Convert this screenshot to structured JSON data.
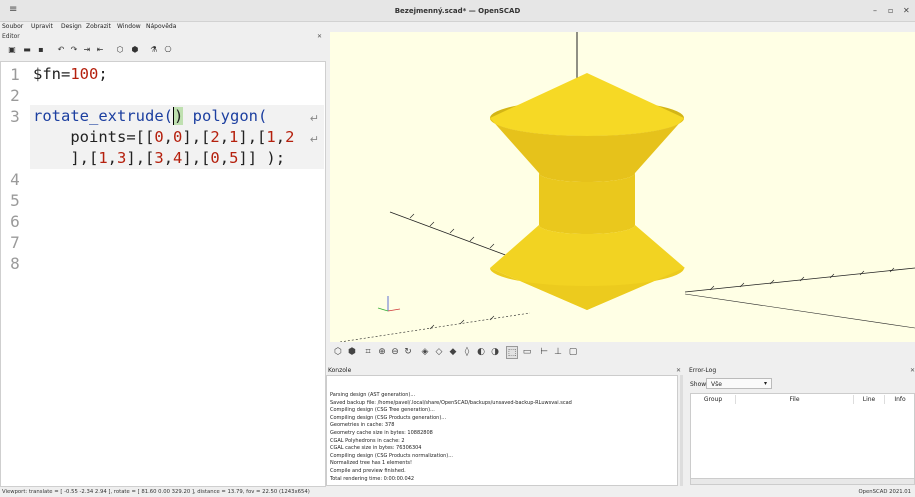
{
  "window": {
    "title": "Bezejmenný.scad* — OpenSCAD"
  },
  "menu": [
    "Soubor",
    "Upravit",
    "Design",
    "Zobrazit",
    "Window",
    "Nápověda"
  ],
  "editor": {
    "label": "Editor",
    "line_numbers": [
      "1",
      "2",
      "3",
      "4",
      "5",
      "6",
      "7",
      "8"
    ],
    "code": {
      "l1a": "$fn=",
      "l1b": "100",
      "l1c": ";",
      "l3a": "rotate_extrude(",
      "l3b": ")",
      "l3c": " polygon(",
      "l4a": "    points=[[",
      "l4b": "0",
      "l4c": ",",
      "l4d": "0",
      "l4e": "],[",
      "l4f": "2",
      "l4g": ",",
      "l4h": "1",
      "l4i": "],[",
      "l4j": "1",
      "l4k": ",",
      "l4l": "2",
      "l5a": "    ],[",
      "l5b": "1",
      "l5c": ",",
      "l5d": "3",
      "l5e": "],[",
      "l5f": "3",
      "l5g": ",",
      "l5h": "4",
      "l5i": "],[",
      "l5j": "0",
      "l5k": ",",
      "l5l": "5",
      "l5m": "]] );"
    }
  },
  "console": {
    "label": "Konzole",
    "lines": [
      "Parsing design (AST generation)...",
      "Saved backup file: /home/pavel/.local/share/OpenSCAD/backups/unsaved-backup-RLuwsvai.scad",
      "Compiling design (CSG Tree generation)...",
      "Compiling design (CSG Products generation)...",
      "Geometries in cache: 378",
      "Geometry cache size in bytes: 10882808",
      "CGAL Polyhedrons in cache: 2",
      "CGAL cache size in bytes: 76306304",
      "Compiling design (CSG Products normalization)...",
      "Normalized tree has 1 elements!",
      "Compile and preview finished.",
      "Total rendering time: 0:00:00.042"
    ]
  },
  "errorlog": {
    "label": "Error-Log",
    "show_label": "Show",
    "show_value": "Vše",
    "columns": [
      "Group",
      "File",
      "Line",
      "Info"
    ]
  },
  "status": {
    "viewport": "Viewport: translate = [ -0.55 -2.34 2.94 ], rotate = [ 81.60 0.00 329.20 ], distance = 13.79, fov = 22.50 (1243x654)",
    "version": "OpenSCAD 2021.01"
  },
  "colors": {
    "model": "#f4d620",
    "viewport_bg": "#ffffe5",
    "keyword": "#1c3fa0",
    "number": "#b5200d"
  }
}
